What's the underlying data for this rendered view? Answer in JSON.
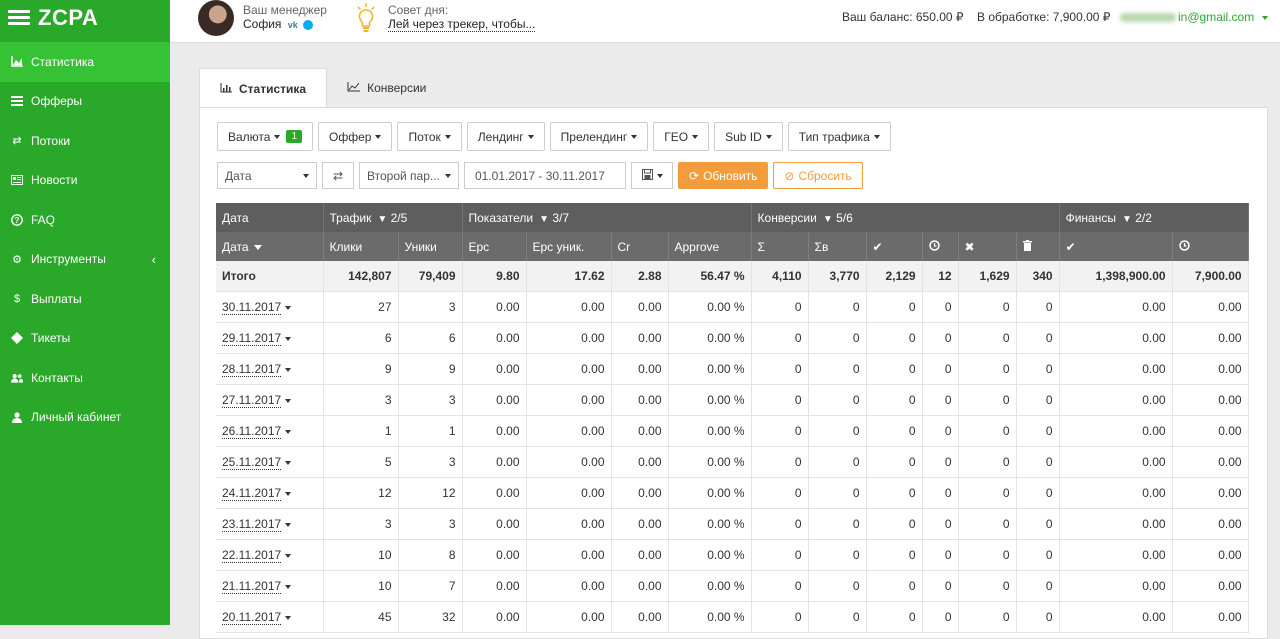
{
  "brand": {
    "name": "ZCPA"
  },
  "sidebar": {
    "items": [
      {
        "label": "Статистика",
        "icon": "area-chart-icon"
      },
      {
        "label": "Офферы",
        "icon": "list-icon"
      },
      {
        "label": "Потоки",
        "icon": "exchange-icon"
      },
      {
        "label": "Новости",
        "icon": "newspaper-icon"
      },
      {
        "label": "FAQ",
        "icon": "question-icon"
      },
      {
        "label": "Инструменты",
        "icon": "gear-icon"
      },
      {
        "label": "Выплаты",
        "icon": "dollar-icon"
      },
      {
        "label": "Тикеты",
        "icon": "ticket-icon"
      },
      {
        "label": "Контакты",
        "icon": "users-icon"
      },
      {
        "label": "Личный кабинет",
        "icon": "user-icon"
      }
    ]
  },
  "header": {
    "manager_title": "Ваш менеджер",
    "manager_name": "София",
    "manager_vk": "vk",
    "tip_title": "Совет дня:",
    "tip_text": "Лей через трекер, чтобы...",
    "balance": "Ваш баланс: 650.00 ₽",
    "processing": "В обработке: 7,900.00 ₽",
    "email": "in@gmail.com"
  },
  "tabs": [
    {
      "label": "Статистика"
    },
    {
      "label": "Конверсии"
    }
  ],
  "filters": {
    "currency": "Валюта",
    "currency_badge": "1",
    "offer": "Оффер",
    "flow": "Поток",
    "landing": "Лендинг",
    "prelanding": "Прелендинг",
    "geo": "ГЕО",
    "subid": "Sub ID",
    "traffic_type": "Тип трафика"
  },
  "toolbar": {
    "group_select": "Дата",
    "second_param": "Второй пар...",
    "date_range": "01.01.2017 - 30.11.2017",
    "update": "Обновить",
    "reset": "Сбросить"
  },
  "table": {
    "groups": [
      {
        "label": "Дата",
        "count": ""
      },
      {
        "label": "Трафик",
        "count": "2/5"
      },
      {
        "label": "Показатели",
        "count": "3/7"
      },
      {
        "label": "Конверсии",
        "count": "5/6"
      },
      {
        "label": "Финансы",
        "count": "2/2"
      }
    ],
    "columns": {
      "date": "Дата",
      "clicks": "Клики",
      "uniques": "Уники",
      "epc": "Epc",
      "epc_uniq": "Epc уник.",
      "cr": "Cr",
      "approve": "Approve",
      "sum": "Σ",
      "sum_b": "Σв"
    },
    "total": {
      "label": "Итого",
      "values": [
        "142,807",
        "79,409",
        "9.80",
        "17.62",
        "2.88",
        "56.47 %",
        "4,110",
        "3,770",
        "2,129",
        "12",
        "1,629",
        "340",
        "1,398,900.00",
        "7,900.00"
      ]
    },
    "rows": [
      {
        "date": "30.11.2017",
        "values": [
          "27",
          "3",
          "0.00",
          "0.00",
          "0.00",
          "0.00 %",
          "0",
          "0",
          "0",
          "0",
          "0",
          "0",
          "0.00",
          "0.00"
        ]
      },
      {
        "date": "29.11.2017",
        "values": [
          "6",
          "6",
          "0.00",
          "0.00",
          "0.00",
          "0.00 %",
          "0",
          "0",
          "0",
          "0",
          "0",
          "0",
          "0.00",
          "0.00"
        ]
      },
      {
        "date": "28.11.2017",
        "values": [
          "9",
          "9",
          "0.00",
          "0.00",
          "0.00",
          "0.00 %",
          "0",
          "0",
          "0",
          "0",
          "0",
          "0",
          "0.00",
          "0.00"
        ]
      },
      {
        "date": "27.11.2017",
        "values": [
          "3",
          "3",
          "0.00",
          "0.00",
          "0.00",
          "0.00 %",
          "0",
          "0",
          "0",
          "0",
          "0",
          "0",
          "0.00",
          "0.00"
        ]
      },
      {
        "date": "26.11.2017",
        "values": [
          "1",
          "1",
          "0.00",
          "0.00",
          "0.00",
          "0.00 %",
          "0",
          "0",
          "0",
          "0",
          "0",
          "0",
          "0.00",
          "0.00"
        ]
      },
      {
        "date": "25.11.2017",
        "values": [
          "5",
          "3",
          "0.00",
          "0.00",
          "0.00",
          "0.00 %",
          "0",
          "0",
          "0",
          "0",
          "0",
          "0",
          "0.00",
          "0.00"
        ]
      },
      {
        "date": "24.11.2017",
        "values": [
          "12",
          "12",
          "0.00",
          "0.00",
          "0.00",
          "0.00 %",
          "0",
          "0",
          "0",
          "0",
          "0",
          "0",
          "0.00",
          "0.00"
        ]
      },
      {
        "date": "23.11.2017",
        "values": [
          "3",
          "3",
          "0.00",
          "0.00",
          "0.00",
          "0.00 %",
          "0",
          "0",
          "0",
          "0",
          "0",
          "0",
          "0.00",
          "0.00"
        ]
      },
      {
        "date": "22.11.2017",
        "values": [
          "10",
          "8",
          "0.00",
          "0.00",
          "0.00",
          "0.00 %",
          "0",
          "0",
          "0",
          "0",
          "0",
          "0",
          "0.00",
          "0.00"
        ]
      },
      {
        "date": "21.11.2017",
        "values": [
          "10",
          "7",
          "0.00",
          "0.00",
          "0.00",
          "0.00 %",
          "0",
          "0",
          "0",
          "0",
          "0",
          "0",
          "0.00",
          "0.00"
        ]
      },
      {
        "date": "20.11.2017",
        "values": [
          "45",
          "32",
          "0.00",
          "0.00",
          "0.00",
          "0.00 %",
          "0",
          "0",
          "0",
          "0",
          "0",
          "0",
          "0.00",
          "0.00"
        ]
      }
    ]
  }
}
